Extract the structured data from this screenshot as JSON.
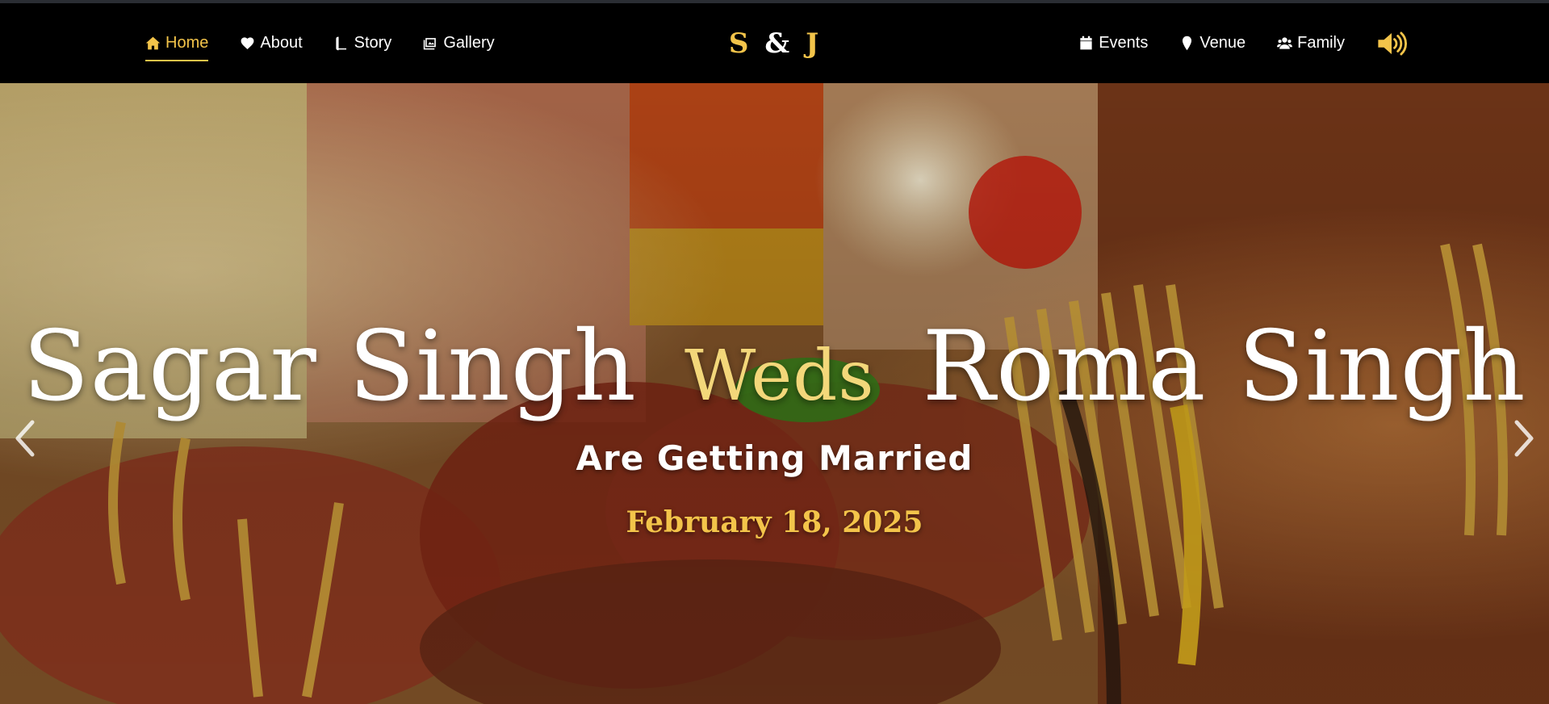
{
  "nav": {
    "left": [
      {
        "label": "Home",
        "icon": "home-icon"
      },
      {
        "label": "About",
        "icon": "heart-icon"
      },
      {
        "label": "Story",
        "icon": "book-icon"
      },
      {
        "label": "Gallery",
        "icon": "images-icon"
      }
    ],
    "right": [
      {
        "label": "Events",
        "icon": "calendar-icon"
      },
      {
        "label": "Venue",
        "icon": "map-pin-icon"
      },
      {
        "label": "Family",
        "icon": "users-icon"
      }
    ],
    "audio_icon": "volume-up-icon",
    "active": "Home"
  },
  "brand": {
    "first_initial": "S",
    "ampersand": "&",
    "second_initial": "J"
  },
  "hero": {
    "groom": "Sagar Singh",
    "connector": "Weds",
    "bride": "Roma Singh",
    "tagline": "Are Getting Married",
    "date": "February 18, 2025",
    "prev_icon": "chevron-left-icon",
    "next_icon": "chevron-right-icon"
  },
  "colors": {
    "accent": "#f3c44a",
    "weds": "#f3d77a",
    "navbar": "#000000",
    "text": "#ffffff"
  }
}
